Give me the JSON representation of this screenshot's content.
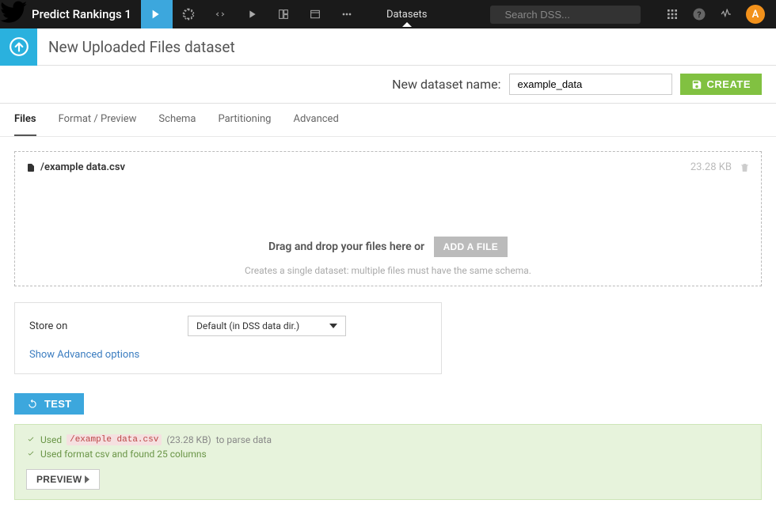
{
  "topbar": {
    "project_name": "Predict Rankings 1",
    "datasets_label": "Datasets",
    "search_placeholder": "Search DSS...",
    "avatar_letter": "A"
  },
  "subheader": {
    "title": "New Uploaded Files dataset"
  },
  "create": {
    "label": "New dataset name:",
    "value": "example_data",
    "button": "CREATE"
  },
  "tabs": {
    "files": "Files",
    "format": "Format / Preview",
    "schema": "Schema",
    "partitioning": "Partitioning",
    "advanced": "Advanced"
  },
  "uploaded_file": {
    "name": "/example data.csv",
    "size": "23.28 KB"
  },
  "dropzone": {
    "instruction": "Drag and drop your files here or",
    "add_button": "ADD A FILE",
    "hint": "Creates a single dataset: multiple files must have the same schema."
  },
  "store": {
    "label": "Store on",
    "selected": "Default (in DSS data dir.)",
    "advanced_link": "Show Advanced options"
  },
  "test_button": "TEST",
  "results": {
    "line1_prefix": "Used",
    "line1_file": "/example data.csv",
    "line1_size": "(23.28 KB)",
    "line1_suffix": "to parse data",
    "line2": "Used format csv and found 25 columns",
    "preview_button": "PREVIEW"
  }
}
